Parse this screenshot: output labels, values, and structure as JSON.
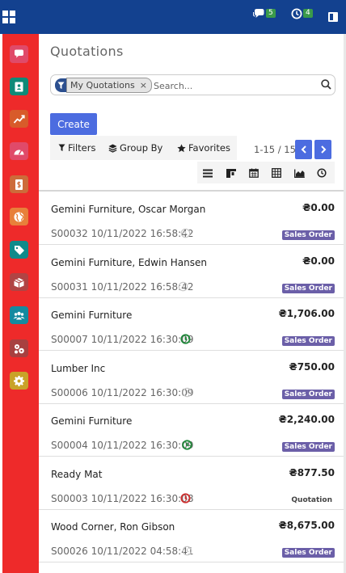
{
  "topbar": {
    "messages_badge": "5",
    "activities_badge": "4",
    "colors": {
      "bar": "#13418f",
      "badge": "#3a9a4a"
    }
  },
  "sidebar": {
    "color": "#ee2a2a",
    "apps": [
      {
        "icon": "chat-icon",
        "bg": "#e04a69"
      },
      {
        "icon": "contacts-icon",
        "bg": "#0f8a78"
      },
      {
        "icon": "chart-icon",
        "bg": "#d85b2a"
      },
      {
        "icon": "dashboard-icon",
        "bg": "#e04a69"
      },
      {
        "icon": "invoice-icon",
        "bg": "#cd6b3a"
      },
      {
        "icon": "globe-icon",
        "bg": "#e8803a"
      },
      {
        "icon": "tag-icon",
        "bg": "#0f8a8a"
      },
      {
        "icon": "inventory-icon",
        "bg": "#b04444"
      },
      {
        "icon": "team-icon",
        "bg": "#158aa0"
      },
      {
        "icon": "manufacturing-icon",
        "bg": "#a84040"
      },
      {
        "icon": "settings-icon",
        "bg": "#c9a228"
      }
    ]
  },
  "page": {
    "title": "Quotations"
  },
  "search": {
    "facet": "My Quotations",
    "placeholder": "Search..."
  },
  "buttons": {
    "create": "Create"
  },
  "filters": {
    "filters": "Filters",
    "group_by": "Group By",
    "favorites": "Favorites"
  },
  "pager": {
    "text": "1-15 / 15"
  },
  "rows": [
    {
      "name": "Gemini Furniture, Oscar Morgan",
      "amount": "₴0.00",
      "ref": "S00032 10/11/2022 16:58:42",
      "status": "Sales Order",
      "clock": "grey"
    },
    {
      "name": "Gemini Furniture, Edwin Hansen",
      "amount": "₴0.00",
      "ref": "S00031 10/11/2022 16:58:42",
      "status": "Sales Order",
      "clock": "grey"
    },
    {
      "name": "Gemini Furniture",
      "amount": "₴1,706.00",
      "ref": "S00007 10/11/2022 16:30:09",
      "status": "Sales Order",
      "clock": "green"
    },
    {
      "name": "Lumber Inc",
      "amount": "₴750.00",
      "ref": "S00006 10/11/2022 16:30:09",
      "status": "Sales Order",
      "clock": "grey"
    },
    {
      "name": "Gemini Furniture",
      "amount": "₴2,240.00",
      "ref": "S00004 10/11/2022 16:30:09",
      "status": "Sales Order",
      "clock": "green"
    },
    {
      "name": "Ready Mat",
      "amount": "₴877.50",
      "ref": "S00003 10/11/2022 16:30:08",
      "status": "Quotation",
      "clock": "red"
    },
    {
      "name": "Wood Corner, Ron Gibson",
      "amount": "₴8,675.00",
      "ref": "S00026 10/11/2022 04:58:41",
      "status": "Sales Order",
      "clock": "grey"
    }
  ],
  "clock_colors": {
    "grey": "#c8c8c8",
    "green": "#1f8a3a",
    "red": "#d03030"
  }
}
